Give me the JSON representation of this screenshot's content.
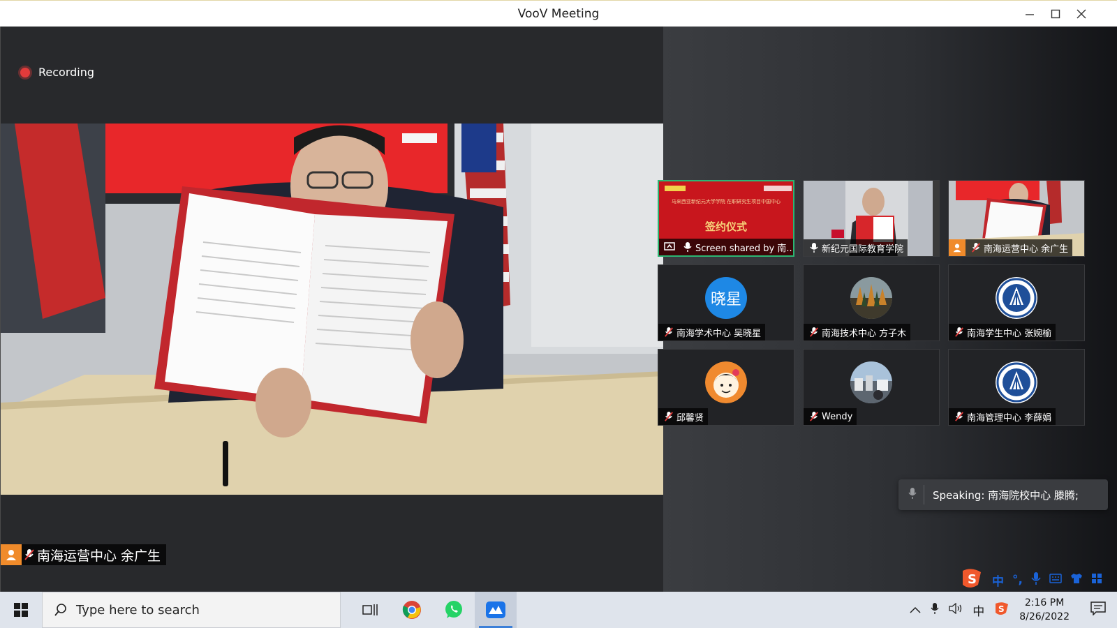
{
  "window": {
    "title": "VooV Meeting"
  },
  "recording": {
    "label": "Recording"
  },
  "speaker": {
    "name": "南海运营中心 余广生"
  },
  "tiles": [
    {
      "label": "Screen shared by 南...",
      "slide_title": "签约仪式",
      "slide_subtitle": "马来西亚新纪元大学学院 在职研究生项目中国中心"
    },
    {
      "label": "新纪元国际教育学院"
    },
    {
      "label": "南海运营中心 余广生"
    },
    {
      "label": "南海学术中心 吴晓星",
      "avatar_text": "晓星"
    },
    {
      "label": "南海技术中心 方子木"
    },
    {
      "label": "南海学生中心 张婉榆"
    },
    {
      "label": "邱馨贤"
    },
    {
      "label": "Wendy"
    },
    {
      "label": "南海管理中心 李薛娟"
    }
  ],
  "speaking": {
    "text": "Speaking: 南海院校中心 滕腾;"
  },
  "ime": {
    "lang": "中",
    "punct": "°,"
  },
  "taskbar": {
    "search_placeholder": "Type here to search",
    "tray_lang": "中",
    "time": "2:16 PM",
    "date": "8/26/2022"
  },
  "colors": {
    "accent_green": "#2bb673",
    "record_red": "#e23b3b",
    "avatar_blue": "#1e88e5"
  }
}
